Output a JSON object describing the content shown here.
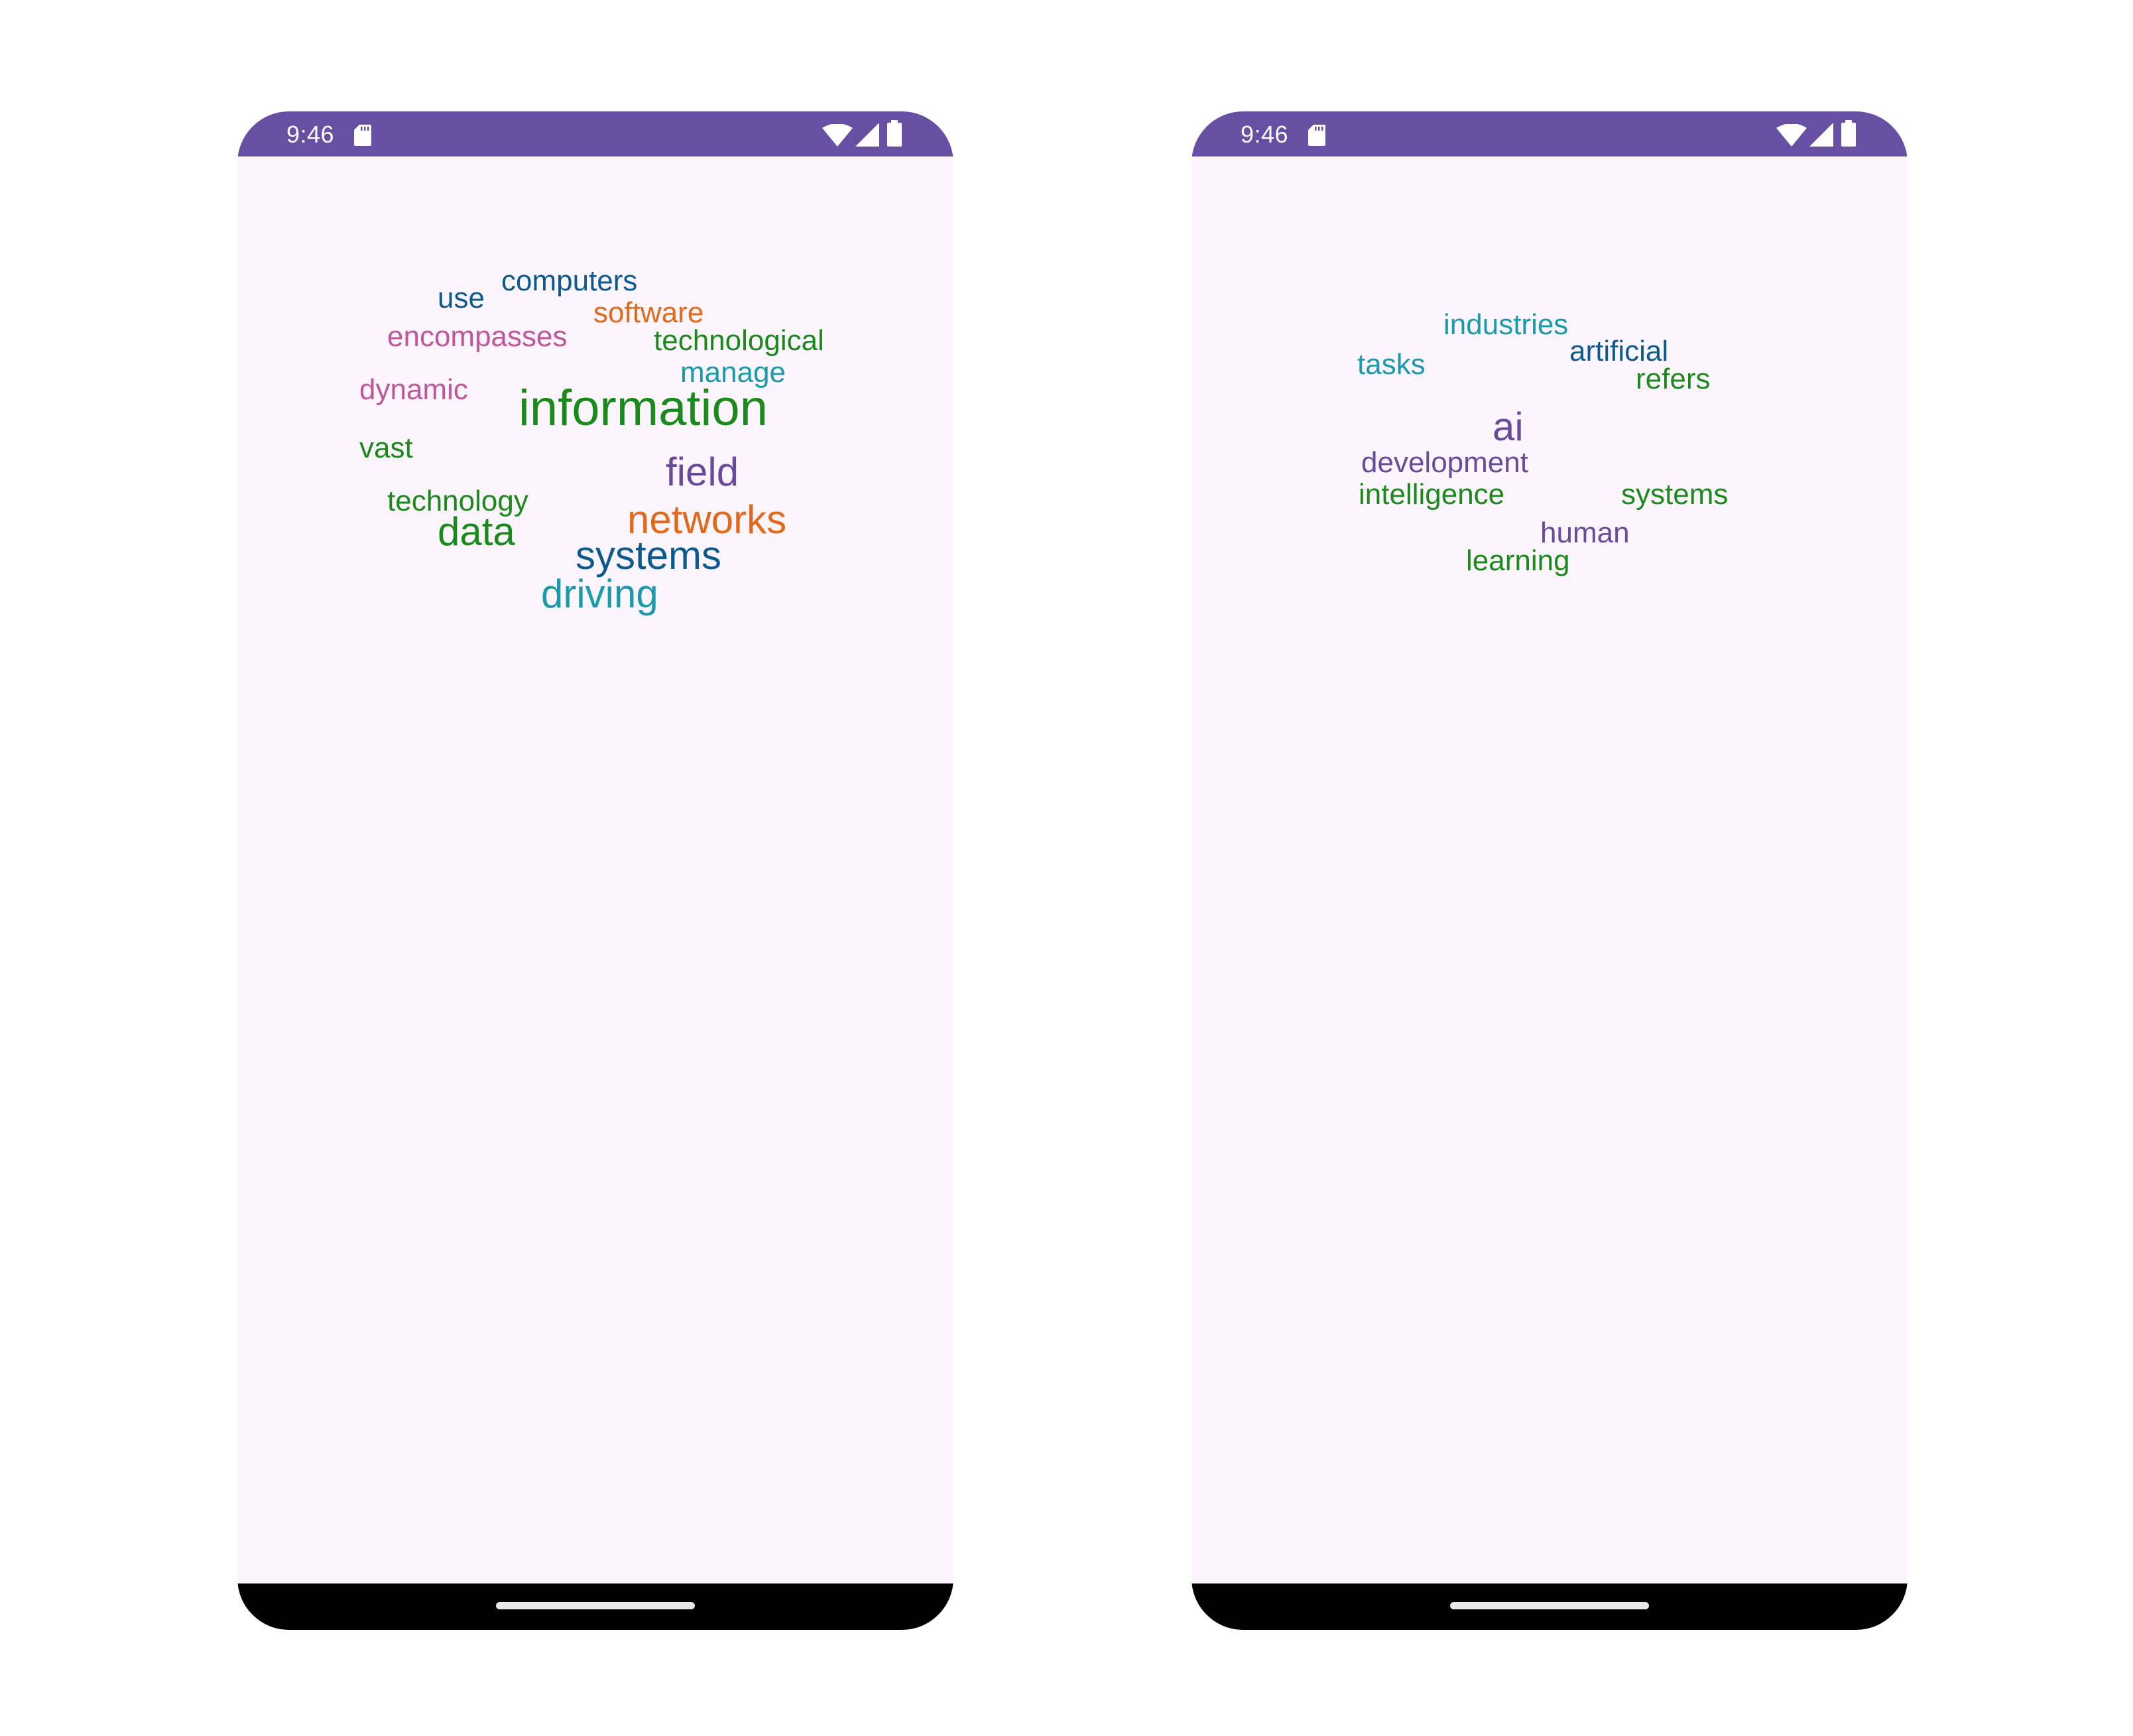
{
  "phones": [
    {
      "status_bar": {
        "time": "9:46",
        "background": "#6750a4"
      },
      "words": [
        {
          "text": "computers",
          "color": "#0b5a8f"
        },
        {
          "text": "use",
          "color": "#0b5a8f"
        },
        {
          "text": "software",
          "color": "#e0691a"
        },
        {
          "text": "encompasses",
          "color": "#c0579a"
        },
        {
          "text": "technological",
          "color": "#1a8a1a"
        },
        {
          "text": "manage",
          "color": "#1a9aaa"
        },
        {
          "text": "dynamic",
          "color": "#c0579a"
        },
        {
          "text": "information",
          "color": "#1a8a1a"
        },
        {
          "text": "vast",
          "color": "#1a8a1a"
        },
        {
          "text": "field",
          "color": "#6a4a9a"
        },
        {
          "text": "technology",
          "color": "#1a8a1a"
        },
        {
          "text": "networks",
          "color": "#e0691a"
        },
        {
          "text": "data",
          "color": "#1a8a1a"
        },
        {
          "text": "systems",
          "color": "#0b5a8f"
        },
        {
          "text": "driving",
          "color": "#1a9aaa"
        }
      ]
    },
    {
      "status_bar": {
        "time": "9:46",
        "background": "#6750a4"
      },
      "words": [
        {
          "text": "industries",
          "color": "#1a9aaa"
        },
        {
          "text": "artificial",
          "color": "#0b5a8f"
        },
        {
          "text": "tasks",
          "color": "#1a9aaa"
        },
        {
          "text": "refers",
          "color": "#1a8a1a"
        },
        {
          "text": "ai",
          "color": "#6a4a9a"
        },
        {
          "text": "development",
          "color": "#6a4a9a"
        },
        {
          "text": "intelligence",
          "color": "#1a8a1a"
        },
        {
          "text": "systems",
          "color": "#1a8a1a"
        },
        {
          "text": "human",
          "color": "#6a4a9a"
        },
        {
          "text": "learning",
          "color": "#1a8a1a"
        }
      ]
    }
  ]
}
